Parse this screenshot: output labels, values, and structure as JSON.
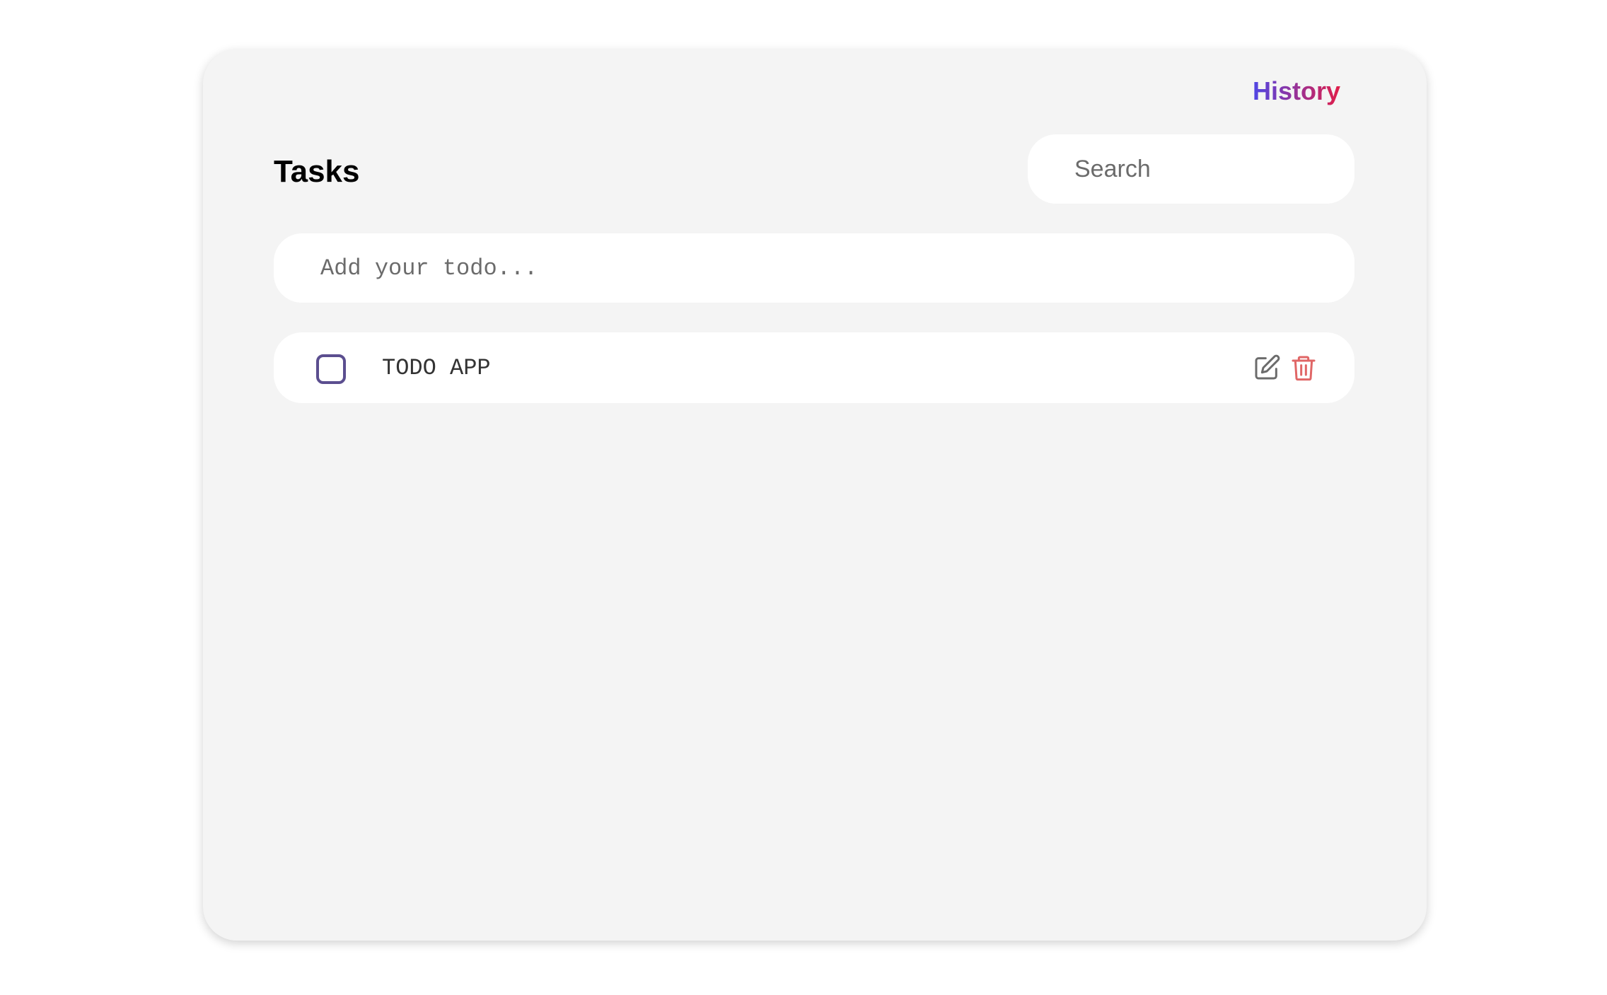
{
  "header": {
    "history_label": "History",
    "title": "Tasks"
  },
  "search": {
    "placeholder": "Search",
    "value": ""
  },
  "add_todo": {
    "placeholder": "Add your todo...",
    "value": ""
  },
  "todos": [
    {
      "text": "TODO APP",
      "completed": false
    }
  ],
  "icons": {
    "edit": "edit-icon",
    "delete": "trash-icon"
  },
  "colors": {
    "history_gradient_start": "#4f46e5",
    "history_gradient_end": "#e11d48",
    "checkbox_border": "#5b4e8f",
    "delete_icon": "#e06666",
    "edit_icon": "#6b6b6b",
    "card_background": "#f4f4f4"
  }
}
